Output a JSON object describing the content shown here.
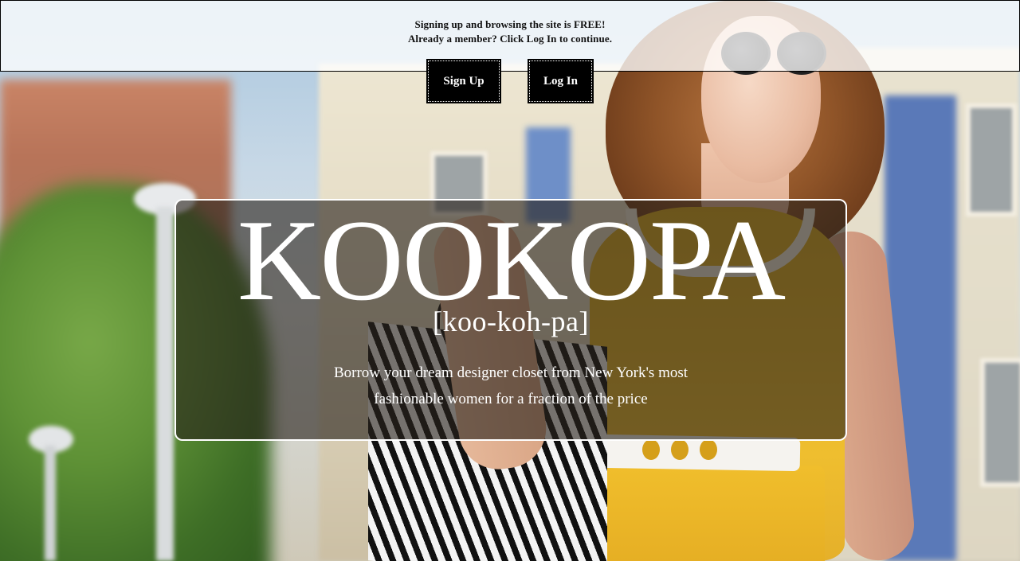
{
  "notice": {
    "line1": "Signing up and browsing the site is FREE!",
    "line2": "Already a member? Click Log In to continue."
  },
  "auth": {
    "signup_label": "Sign Up",
    "login_label": "Log In"
  },
  "hero": {
    "brand": "KOOKOPA",
    "pronunciation": "[koo-koh-pa]",
    "tagline_line1": "Borrow your dream designer closet from New York's most",
    "tagline_line2": "fashionable women for a fraction of the price"
  },
  "background": {
    "description_icon": "fashion-photo-background"
  },
  "colors": {
    "button_bg": "#000000",
    "button_text": "#ffffff",
    "notice_bg": "#ffffff",
    "hero_overlay": "#28221c"
  }
}
